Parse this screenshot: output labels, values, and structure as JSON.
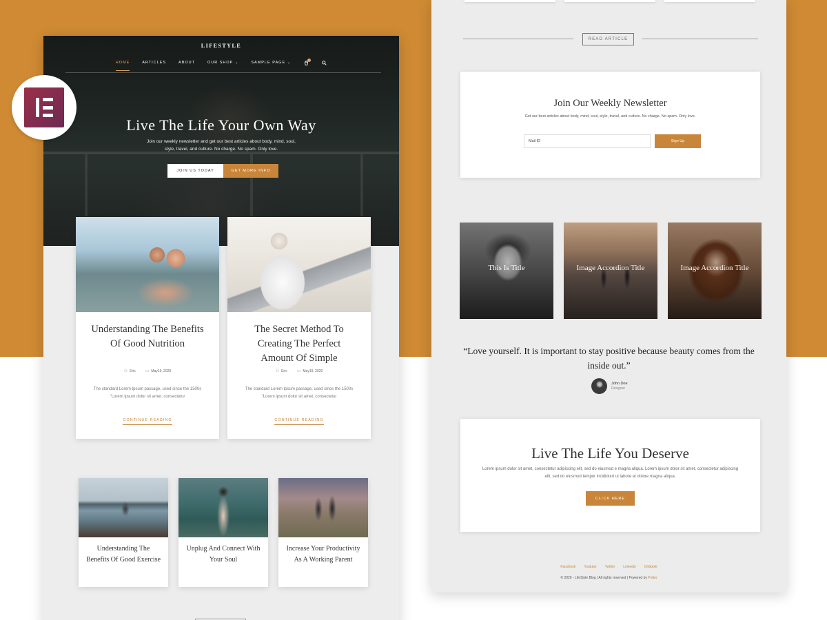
{
  "left": {
    "brand": "LIFESTYLE",
    "nav": [
      "HOME",
      "ARTICLES",
      "ABOUT",
      "OUR SHOP",
      "SAMPLE PAGE"
    ],
    "hero": {
      "title": "Live The Life Your Own Way",
      "subtitle": "Join our weekly newsletter and get our best articles about body, mind, soul, style, travel, and culture. No charge. No spam. Only love.",
      "button_primary": "JOIN US TODAY",
      "button_secondary": "GET MORE INFO"
    },
    "posts": [
      {
        "title": "Understanding The Benefits Of Good Nutrition",
        "author": "Eric",
        "date": "May19, 2020",
        "excerpt": "The standard Lorem Ipsum passage, used since the 1500s \"Lorem ipsum dolor sit amet, consectetur",
        "link": "CONTINUE READING"
      },
      {
        "title": "The Secret Method To Creating The Perfect Amount Of Simple",
        "author": "Eric",
        "date": "May19, 2020",
        "excerpt": "The standard Lorem Ipsum passage, used since the 1500s \"Lorem ipsum dolor sit amet, consectetur",
        "link": "CONTINUE READING"
      }
    ],
    "small_posts": [
      {
        "title": "Understanding The Benefits Of Good Exercise"
      },
      {
        "title": "Unplug And Connect With Your Soul"
      },
      {
        "title": "Increase Your Productivity As A Working Parent"
      }
    ]
  },
  "right": {
    "read_button": "READ ARTICLE",
    "newsletter": {
      "title": "Join Our Weekly Newsletter",
      "subtitle": "Get our best articles about body, mind, soul, style, travel, and culture. No charge. No spam. Only love.",
      "input_value": "Mail ID",
      "button": "Sign Up"
    },
    "accordion": [
      "This Is Title",
      "Image Accordion Title",
      "Image Accordion Title"
    ],
    "testimonial": {
      "quote": "“Love yourself. It is important to stay positive because beauty comes from the inside out.”",
      "name": "John Doe",
      "role": "Designer"
    },
    "cta": {
      "title": "Live The Life You Deserve",
      "text": "Lorem ipsum dolor sit amet, consectetur adipiscing elit, sed do eiusmod e magna aliqua. Lorem ipsum dolor sit amet, consectetur adipiscing elit, sed do eiusmod tempor incididunt ut labore et dolore magna aliqua.",
      "button": "CLICK HERE"
    },
    "footer": {
      "links": [
        "Facebook",
        "Youtube",
        "Twitter",
        "Linkedin",
        "Dribbble"
      ],
      "copyright": "© 2020 - LifeStyle Blog | All rights reserved | Powered by",
      "powered_by": "Potter"
    }
  },
  "colors": {
    "accent": "#c9853a",
    "background": "#cf8a33",
    "elementor": "#92003b"
  },
  "icons": [
    "elementor-logo-icon",
    "cart-icon",
    "search-icon",
    "chevron-down-icon",
    "user-icon",
    "calendar-icon"
  ]
}
